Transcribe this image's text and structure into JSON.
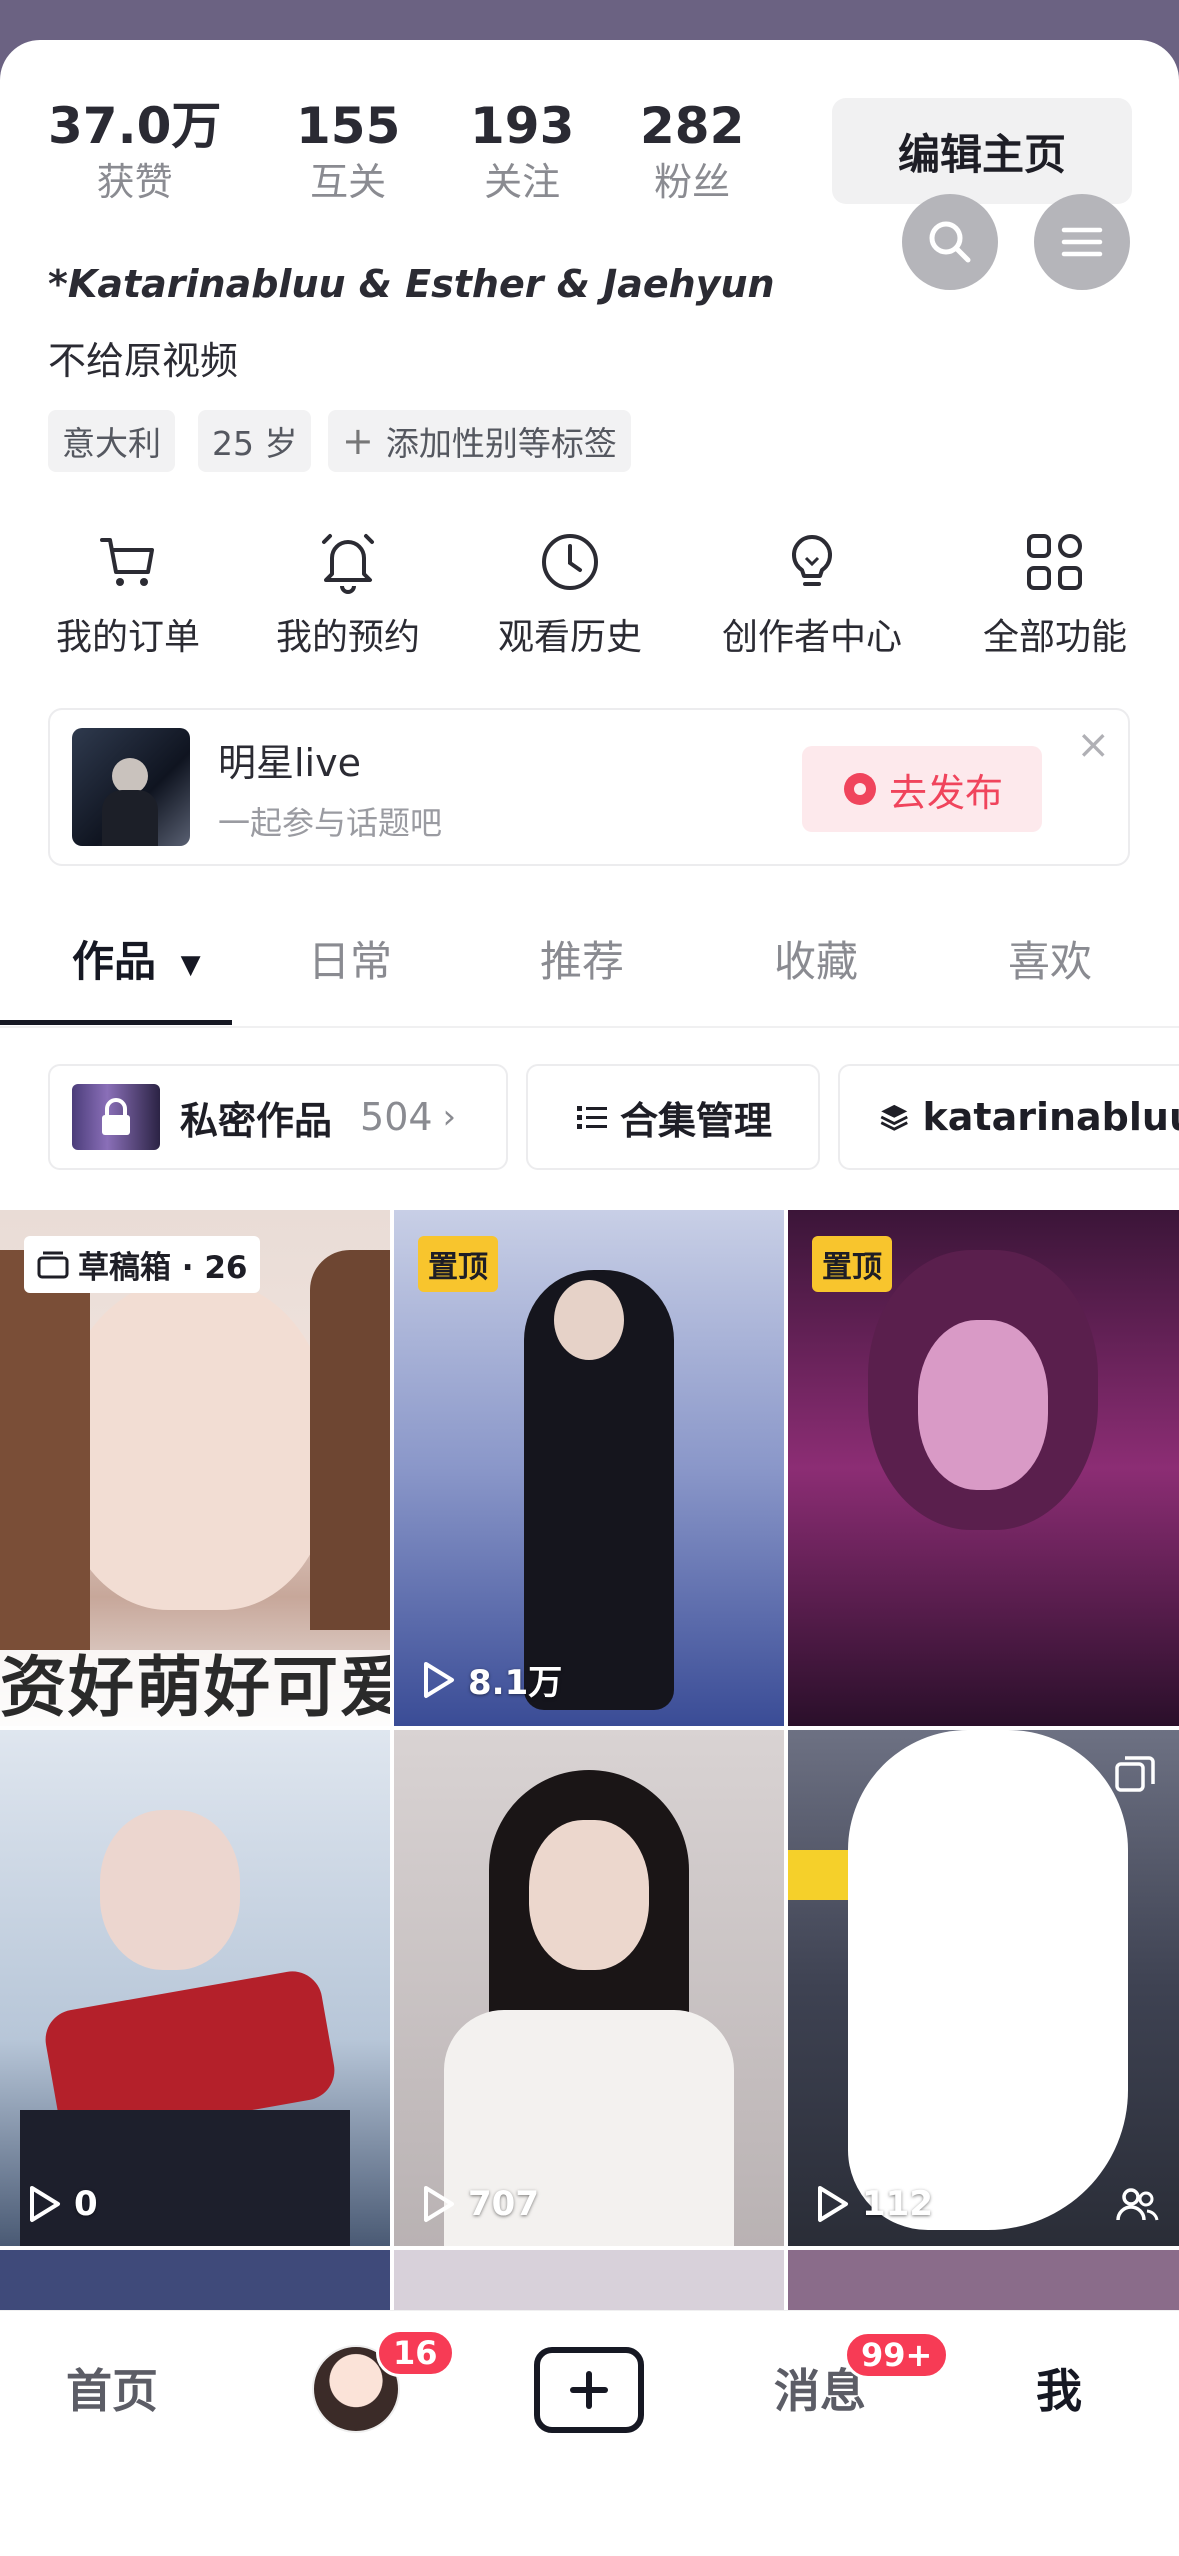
{
  "stats": [
    {
      "num": "37.0万",
      "label": "获赞"
    },
    {
      "num": "155",
      "label": "互关"
    },
    {
      "num": "193",
      "label": "关注"
    },
    {
      "num": "282",
      "label": "粉丝"
    }
  ],
  "edit_profile_label": "编辑主页",
  "username": "*Katarinabluu & Esther & Jaehyun",
  "bio": "不给原视频",
  "tags": [
    "意大利",
    "25 岁",
    "添加性别等标签"
  ],
  "shortcuts": [
    {
      "icon": "cart-icon",
      "label": "我的订单"
    },
    {
      "icon": "bell-icon",
      "label": "我的预约"
    },
    {
      "icon": "clock-icon",
      "label": "观看历史"
    },
    {
      "icon": "lightbulb-icon",
      "label": "创作者中心"
    },
    {
      "icon": "grid-icon",
      "label": "全部功能"
    }
  ],
  "promo": {
    "title": "明星live",
    "subtitle": "一起参与话题吧",
    "button": "去发布",
    "close": "×"
  },
  "tabs": [
    "作品",
    "日常",
    "推荐",
    "收藏",
    "喜欢"
  ],
  "collections": {
    "private_label": "私密作品",
    "private_count": "504",
    "manage_label": "合集管理",
    "collection_name": "katarinabluu"
  },
  "grid": [
    {
      "badge": "草稿箱 · 26",
      "overlay": "资好萌好可爱"
    },
    {
      "badge": "置顶",
      "plays": "8.1万"
    },
    {
      "badge": "置顶"
    },
    {
      "plays": "0"
    },
    {
      "plays": "707"
    },
    {
      "plays": "112"
    }
  ],
  "nav": {
    "home": "首页",
    "friends_badge": "16",
    "messages": "消息",
    "messages_badge": "99+",
    "me": "我"
  },
  "colors": {
    "accent": "#f73b55",
    "pin": "#f8c52d",
    "header": "#6b6282"
  }
}
